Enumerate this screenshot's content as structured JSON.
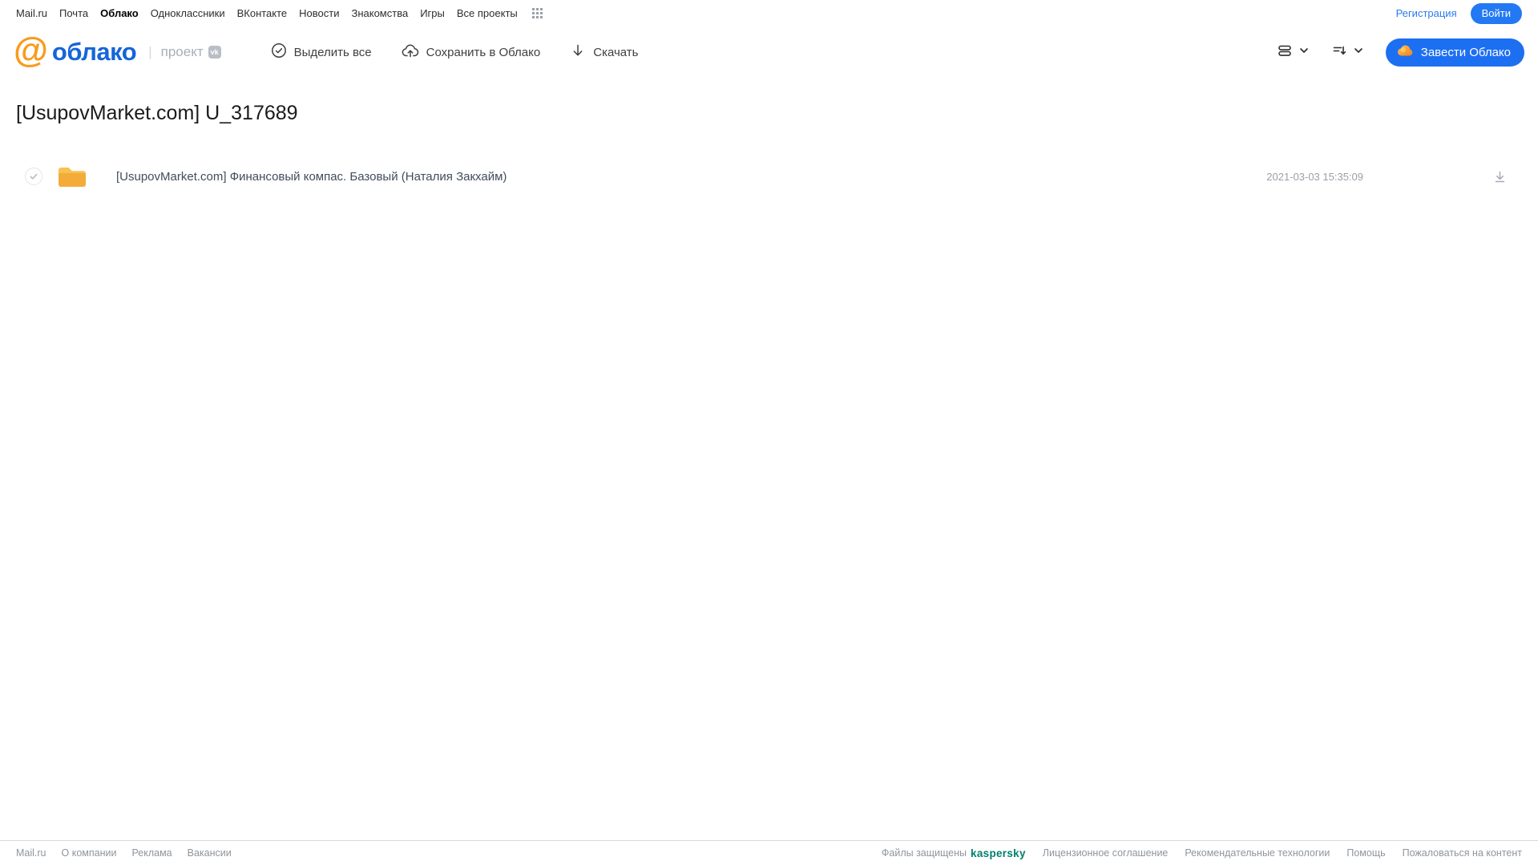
{
  "topnav": {
    "items": [
      {
        "label": "Mail.ru"
      },
      {
        "label": "Почта"
      },
      {
        "label": "Облако",
        "active": true
      },
      {
        "label": "Одноклассники"
      },
      {
        "label": "ВКонтакте"
      },
      {
        "label": "Новости"
      },
      {
        "label": "Знакомства"
      },
      {
        "label": "Игры"
      },
      {
        "label": "Все проекты"
      }
    ],
    "registration_label": "Регистрация",
    "login_label": "Войти"
  },
  "header": {
    "logo_at": "@",
    "logo_text": "облако",
    "project_label": "проект",
    "vk_badge": "vk",
    "toolbar": {
      "select_all_label": "Выделить все",
      "save_label": "Сохранить в Облако",
      "download_label": "Скачать"
    },
    "create_cloud_label": "Завести Облако"
  },
  "main": {
    "title": "[UsupovMarket.com] U_317689",
    "files": [
      {
        "type": "folder",
        "name": "[UsupovMarket.com] Финансовый компас. Базовый (Наталия Закхайм)",
        "date": "2021-03-03 15:35:09"
      }
    ]
  },
  "footer": {
    "left_links": [
      {
        "label": "Mail.ru"
      },
      {
        "label": "О компании"
      },
      {
        "label": "Реклама"
      },
      {
        "label": "Вакансии"
      }
    ],
    "protected_label": "Файлы защищены",
    "kaspersky_label": "kaspersky",
    "right_links": [
      {
        "label": "Лицензионное соглашение"
      },
      {
        "label": "Рекомендательные технологии"
      },
      {
        "label": "Помощь"
      },
      {
        "label": "Пожаловаться на контент"
      }
    ]
  },
  "colors": {
    "accent_blue": "#2379f3",
    "button_blue": "#1d6ff2",
    "logo_blue": "#1565d8",
    "logo_orange": "#f99b1c",
    "folder_yellow": "#f3ac3a",
    "folder_yellow_light": "#f8c150",
    "kaspersky_teal": "#00806c",
    "text_gray": "#9aa0a6"
  }
}
